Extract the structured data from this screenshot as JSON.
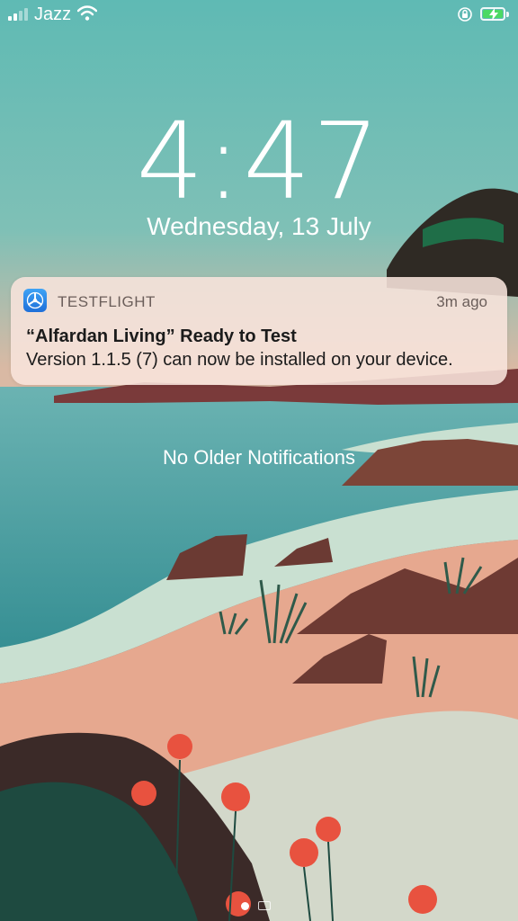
{
  "status_bar": {
    "carrier": "Jazz",
    "signal_bars_active": 2,
    "signal_bars_total": 4,
    "battery_color": "#4cd964",
    "icons": [
      "wifi-icon",
      "rotation-lock-icon",
      "battery-charging-icon"
    ]
  },
  "lock_screen": {
    "time": "4:47",
    "date": "Wednesday, 13 July"
  },
  "notification": {
    "app_name": "TESTFLIGHT",
    "app_icon": "testflight-icon",
    "time_ago": "3m ago",
    "title": "“Alfardan Living” Ready to Test",
    "body": "Version 1.1.5 (7) can now be installed on your device."
  },
  "older_notifications_label": "No Older Notifications",
  "page_indicator": {
    "icons": [
      "page-dot-icon",
      "camera-icon"
    ]
  }
}
